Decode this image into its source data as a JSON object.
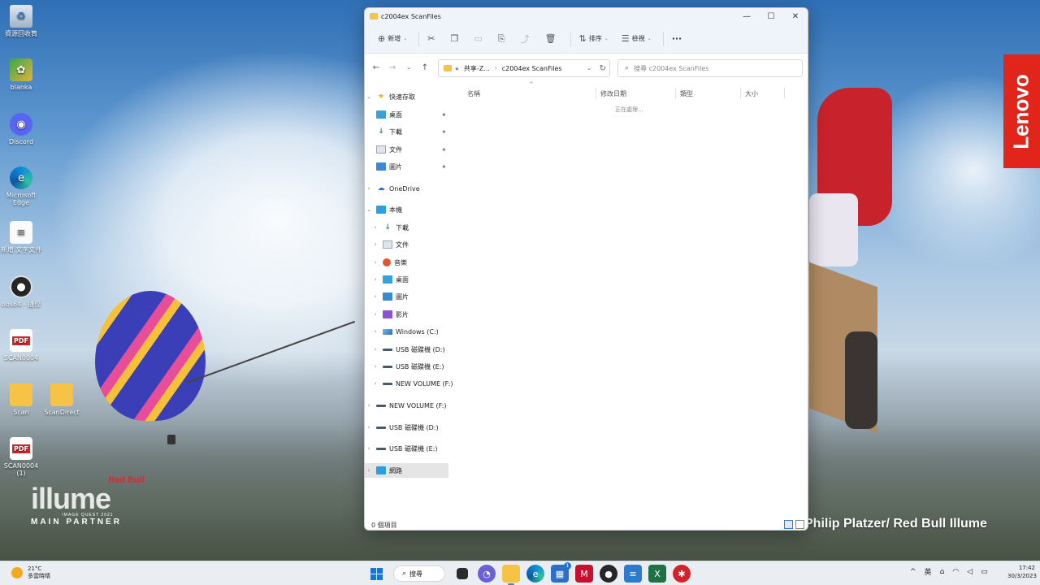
{
  "desktop": {
    "icons": [
      {
        "label": "資源回收筒",
        "glyph": "♻"
      },
      {
        "label": "blanka",
        "glyph": "✿"
      },
      {
        "label": "Discord",
        "glyph": "◉"
      },
      {
        "label": "Microsoft Edge",
        "glyph": "e"
      },
      {
        "label": "新增 文字文件",
        "glyph": "≡"
      },
      {
        "label": "obs64 - 捷徑",
        "glyph": "●"
      },
      {
        "label": "SCAN0004",
        "glyph": "PDF"
      },
      {
        "label": "Scan",
        "glyph": ""
      },
      {
        "label": "ScanDirect",
        "glyph": ""
      },
      {
        "label": "SCAN0004 (1)",
        "glyph": "PDF"
      }
    ],
    "wallpaper": {
      "brand": "Lenovo",
      "credit": "Philip Platzer/ Red Bull Illume",
      "logo_top": "Red Bull",
      "logo_word": "illume",
      "logo_sub": "IMAGE QUEST 2021",
      "logo_bottom": "MAIN PARTNER"
    }
  },
  "explorer": {
    "title": "c2004ex ScanFiles",
    "toolbar": {
      "new_label": "新增",
      "sort_label": "排序",
      "view_label": "檢視",
      "more_label": "···"
    },
    "address": {
      "prefix": "«",
      "segment1": "共享-Z...",
      "segment2": "c2004ex ScanFiles"
    },
    "search_placeholder": "搜尋 c2004ex ScanFiles",
    "nav": {
      "quick_access": "快速存取",
      "qa_items": [
        "桌面",
        "下載",
        "文件",
        "圖片"
      ],
      "onedrive": "OneDrive",
      "this_pc": "本機",
      "pc_items": [
        "下載",
        "文件",
        "音樂",
        "桌面",
        "圖片",
        "影片",
        "Windows (C:)",
        "USB 磁碟機 (D:)",
        "USB 磁碟機 (E:)",
        "NEW VOLUME (F:)"
      ],
      "roots": [
        "NEW VOLUME (F:)",
        "USB 磁碟機 (D:)",
        "USB 磁碟機 (E:)"
      ],
      "network": "網路"
    },
    "columns": [
      "名稱",
      "修改日期",
      "類型",
      "大小"
    ],
    "working_text": "正在處理...",
    "status_text": "0 個項目"
  },
  "taskbar": {
    "weather_temp": "21°C",
    "weather_desc": "多雲時晴",
    "search_label": "搜尋",
    "badge_count": "1",
    "ime_label": "英",
    "time": "17:42",
    "date": "30/3/2023"
  }
}
